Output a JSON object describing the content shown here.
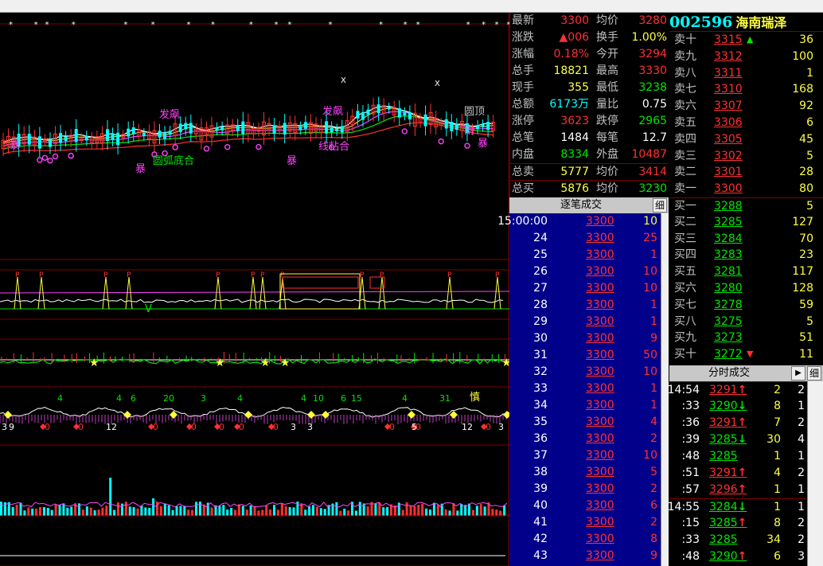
{
  "quote": {
    "rows": [
      {
        "l1": "最新",
        "v1": "3300",
        "c1": "red",
        "l2": "均价",
        "v2": "3280",
        "c2": "red"
      },
      {
        "l1": "涨跌",
        "v1": "▲006",
        "c1": "red",
        "l2": "换手",
        "v2": "1.00%",
        "c2": "yellow"
      },
      {
        "l1": "涨幅",
        "v1": "0.18%",
        "c1": "red",
        "l2": "今开",
        "v2": "3294",
        "c2": "red"
      },
      {
        "l1": "总手",
        "v1": "18821",
        "c1": "yellow",
        "l2": "最高",
        "v2": "3330",
        "c2": "red"
      },
      {
        "l1": "现手",
        "v1": "355",
        "c1": "yellow",
        "l2": "最低",
        "v2": "3238",
        "c2": "green"
      },
      {
        "l1": "总额",
        "v1": "6173万",
        "c1": "cyan",
        "l2": "量比",
        "v2": "0.75",
        "c2": "white"
      },
      {
        "l1": "涨停",
        "v1": "3623",
        "c1": "red",
        "l2": "跌停",
        "v2": "2965",
        "c2": "green"
      },
      {
        "l1": "总笔",
        "v1": "1484",
        "c1": "white",
        "l2": "每笔",
        "v2": "12.7",
        "c2": "white"
      },
      {
        "l1": "内盘",
        "v1": "8334",
        "c1": "green",
        "l2": "外盘",
        "v2": "10487",
        "c2": "red"
      },
      {
        "l1": "总卖",
        "v1": "5777",
        "c1": "yellow",
        "l2": "均价",
        "v2": "3414",
        "c2": "red"
      },
      {
        "l1": "总买",
        "v1": "5876",
        "c1": "yellow",
        "l2": "均价",
        "v2": "3230",
        "c2": "green"
      }
    ]
  },
  "ticks_header": {
    "title": "逐笔成交",
    "detail": "细"
  },
  "ticks": [
    {
      "t": "15:00:00",
      "p": "3300",
      "v": "10",
      "vc": "yellow"
    },
    {
      "t": "24",
      "p": "3300",
      "v": "25",
      "vc": "red"
    },
    {
      "t": "25",
      "p": "3300",
      "v": "1",
      "vc": "red"
    },
    {
      "t": "26",
      "p": "3300",
      "v": "10",
      "vc": "red"
    },
    {
      "t": "27",
      "p": "3300",
      "v": "10",
      "vc": "red"
    },
    {
      "t": "28",
      "p": "3300",
      "v": "1",
      "vc": "red"
    },
    {
      "t": "29",
      "p": "3300",
      "v": "1",
      "vc": "red"
    },
    {
      "t": "30",
      "p": "3300",
      "v": "9",
      "vc": "red"
    },
    {
      "t": "31",
      "p": "3300",
      "v": "50",
      "vc": "red"
    },
    {
      "t": "32",
      "p": "3300",
      "v": "10",
      "vc": "red"
    },
    {
      "t": "33",
      "p": "3300",
      "v": "1",
      "vc": "red"
    },
    {
      "t": "34",
      "p": "3300",
      "v": "1",
      "vc": "red"
    },
    {
      "t": "35",
      "p": "3300",
      "v": "4",
      "vc": "red"
    },
    {
      "t": "36",
      "p": "3300",
      "v": "2",
      "vc": "red"
    },
    {
      "t": "37",
      "p": "3300",
      "v": "10",
      "vc": "red"
    },
    {
      "t": "38",
      "p": "3300",
      "v": "5",
      "vc": "red"
    },
    {
      "t": "39",
      "p": "3300",
      "v": "2",
      "vc": "red"
    },
    {
      "t": "40",
      "p": "3300",
      "v": "6",
      "vc": "red"
    },
    {
      "t": "41",
      "p": "3300",
      "v": "2",
      "vc": "red"
    },
    {
      "t": "42",
      "p": "3300",
      "v": "8",
      "vc": "red"
    },
    {
      "t": "43",
      "p": "3300",
      "v": "9",
      "vc": "red"
    }
  ],
  "title": {
    "code": "002596",
    "name": "海南瑞泽"
  },
  "book": [
    {
      "label": "卖十",
      "price": "3315",
      "pc": "red",
      "arrow": "▲",
      "ac": "green",
      "vol": "36"
    },
    {
      "label": "卖九",
      "price": "3312",
      "pc": "red",
      "arrow": "",
      "ac": "",
      "vol": "100"
    },
    {
      "label": "卖八",
      "price": "3311",
      "pc": "red",
      "arrow": "",
      "ac": "",
      "vol": "1"
    },
    {
      "label": "卖七",
      "price": "3310",
      "pc": "red",
      "arrow": "",
      "ac": "",
      "vol": "168"
    },
    {
      "label": "卖六",
      "price": "3307",
      "pc": "red",
      "arrow": "",
      "ac": "",
      "vol": "92"
    },
    {
      "label": "卖五",
      "price": "3306",
      "pc": "red",
      "arrow": "",
      "ac": "",
      "vol": "6"
    },
    {
      "label": "卖四",
      "price": "3305",
      "pc": "red",
      "arrow": "",
      "ac": "",
      "vol": "45"
    },
    {
      "label": "卖三",
      "price": "3302",
      "pc": "red",
      "arrow": "",
      "ac": "",
      "vol": "5"
    },
    {
      "label": "卖二",
      "price": "3301",
      "pc": "red",
      "arrow": "",
      "ac": "",
      "vol": "28"
    },
    {
      "label": "卖一",
      "price": "3300",
      "pc": "red",
      "arrow": "",
      "ac": "",
      "vol": "80"
    },
    {
      "label": "买一",
      "price": "3288",
      "pc": "green",
      "arrow": "",
      "ac": "",
      "vol": "5"
    },
    {
      "label": "买二",
      "price": "3285",
      "pc": "green",
      "arrow": "",
      "ac": "",
      "vol": "127"
    },
    {
      "label": "买三",
      "price": "3284",
      "pc": "green",
      "arrow": "",
      "ac": "",
      "vol": "70"
    },
    {
      "label": "买四",
      "price": "3283",
      "pc": "green",
      "arrow": "",
      "ac": "",
      "vol": "23"
    },
    {
      "label": "买五",
      "price": "3281",
      "pc": "green",
      "arrow": "",
      "ac": "",
      "vol": "117"
    },
    {
      "label": "买六",
      "price": "3280",
      "pc": "green",
      "arrow": "",
      "ac": "",
      "vol": "128"
    },
    {
      "label": "买七",
      "price": "3278",
      "pc": "green",
      "arrow": "",
      "ac": "",
      "vol": "59"
    },
    {
      "label": "买八",
      "price": "3275",
      "pc": "green",
      "arrow": "",
      "ac": "",
      "vol": "5"
    },
    {
      "label": "买九",
      "price": "3273",
      "pc": "green",
      "arrow": "",
      "ac": "",
      "vol": "51"
    },
    {
      "label": "买十",
      "price": "3272",
      "pc": "green",
      "arrow": "▼",
      "ac": "red",
      "vol": "11"
    }
  ],
  "fs_header": {
    "title": "分时成交",
    "play": "▶",
    "detail": "细"
  },
  "fs": [
    {
      "t": "14:54",
      "p": "3291",
      "pc": "red",
      "a": "↑",
      "ac": "red",
      "v": "2",
      "vc": "red",
      "n": "2"
    },
    {
      "t": ":33",
      "p": "3290",
      "pc": "green",
      "a": "↓",
      "ac": "green",
      "v": "8",
      "vc": "green",
      "n": "1"
    },
    {
      "t": ":36",
      "p": "3291",
      "pc": "red",
      "a": "↑",
      "ac": "red",
      "v": "7",
      "vc": "red",
      "n": "2"
    },
    {
      "t": ":39",
      "p": "3285",
      "pc": "green",
      "a": "↓",
      "ac": "green",
      "v": "30",
      "vc": "green",
      "n": "4"
    },
    {
      "t": ":48",
      "p": "3285",
      "pc": "green",
      "a": "",
      "ac": "",
      "v": "1",
      "vc": "green",
      "n": "1"
    },
    {
      "t": ":51",
      "p": "3291",
      "pc": "red",
      "a": "↑",
      "ac": "red",
      "v": "4",
      "vc": "red",
      "n": "2"
    },
    {
      "t": ":57",
      "p": "3296",
      "pc": "red",
      "a": "↑",
      "ac": "red",
      "v": "1",
      "vc": "red",
      "n": "1"
    },
    {
      "t": "14:55",
      "p": "3284",
      "pc": "green",
      "a": "↓",
      "ac": "green",
      "v": "1",
      "vc": "green",
      "n": "1"
    },
    {
      "t": ":15",
      "p": "3285",
      "pc": "green",
      "a": "↑",
      "ac": "red",
      "v": "8",
      "vc": "red",
      "n": "2"
    },
    {
      "t": ":33",
      "p": "3285",
      "pc": "green",
      "a": "",
      "ac": "",
      "v": "34",
      "vc": "green",
      "n": "2"
    },
    {
      "t": ":48",
      "p": "3290",
      "pc": "green",
      "a": "↑",
      "ac": "red",
      "v": "6",
      "vc": "red",
      "n": "3"
    }
  ],
  "chart": {
    "labels": [
      {
        "text": "发飙",
        "color": "#ff40ff"
      },
      {
        "text": "暴",
        "color": "#ff40ff"
      },
      {
        "text": "暴",
        "color": "#ff40ff"
      },
      {
        "text": "暴",
        "color": "#ff40ff"
      },
      {
        "text": "圆弧底合",
        "color": "#00e600"
      },
      {
        "text": "发飙",
        "color": "#ff40ff"
      },
      {
        "text": "线粘合",
        "color": "#ff40ff"
      },
      {
        "text": "圆顶",
        "color": "#c0c0c0"
      },
      {
        "text": "雨",
        "color": "#ff40ff"
      },
      {
        "text": "暴",
        "color": "#ff40ff"
      },
      {
        "text": "X",
        "color": "#ffffff"
      },
      {
        "text": "X",
        "color": "#ffffff"
      },
      {
        "text": "V",
        "color": "#00e600"
      },
      {
        "text": "慎",
        "color": "#ffff40"
      }
    ],
    "bottom_nums": [
      "3",
      "9",
      "0",
      "0",
      "12",
      "0",
      "0",
      "0",
      "0",
      "0",
      "3",
      "3",
      "0",
      "0",
      "5",
      "12",
      "0",
      "3"
    ],
    "green_nums": [
      "4",
      "4",
      "6",
      "20",
      "3",
      "4",
      "4",
      "10",
      "6",
      "15",
      "4",
      "31"
    ]
  }
}
